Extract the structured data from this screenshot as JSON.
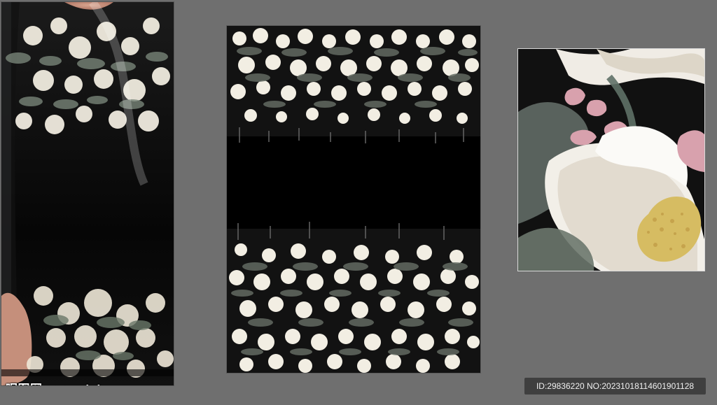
{
  "watermark": {
    "text": "昵图网 www.nipic.com"
  },
  "id_info": {
    "text": "ID:29836220 NO:20231018114601901128"
  },
  "colors": {
    "background": "#6f6f6f",
    "print_background": "#000000",
    "petal": "#f3efe6",
    "petal_shade": "#d9d1c1",
    "pollen": "#d5b85a",
    "leaf": "#6d786d",
    "pink_bud": "#d8a1ad"
  },
  "icons": {
    "dress_photo": "dress-photo-icon",
    "print_pattern": "floral-print-icon",
    "detail_crop": "flower-detail-icon"
  }
}
